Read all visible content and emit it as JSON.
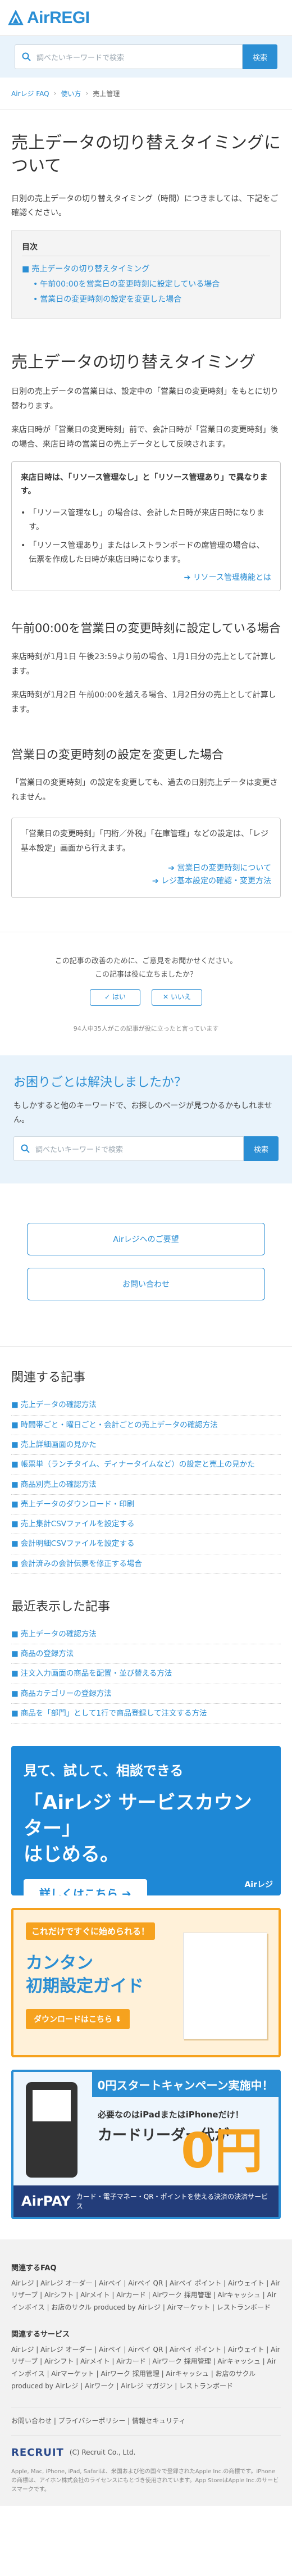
{
  "header": {
    "logo_text": "AirREGI"
  },
  "search": {
    "placeholder": "調べたいキーワードで検索",
    "button": "検索"
  },
  "breadcrumb": [
    "Airレジ FAQ",
    "使い方",
    "売上管理"
  ],
  "article": {
    "title": "売上データの切り替えタイミングについて",
    "intro": "日別の売上データの切り替えタイミング（時間）につきましては、下記をご確認ください。",
    "toc": {
      "title": "目次",
      "items": [
        {
          "label": "売上データの切り替えタイミング",
          "sub": false
        },
        {
          "label": "午前00:00を営業日の変更時刻に設定している場合",
          "sub": true
        },
        {
          "label": "営業日の変更時刻の設定を変更した場合",
          "sub": true
        }
      ]
    },
    "s1": {
      "title": "売上データの切り替えタイミング",
      "p1": "日別の売上データの営業日は、設定中の「営業日の変更時刻」をもとに切り替わります。",
      "p2": "来店日時が「営業日の変更時刻」前で、会計日時が「営業日の変更時刻」後の場合、来店日時の営業日の売上データとして反映されます。",
      "note": {
        "title": "来店日時は、「リソース管理なし」と「リソース管理あり」で異なります。",
        "items": [
          "「リソース管理なし」の場合は、会計した日時が来店日時になります。",
          "「リソース管理あり」またはレストランボードの席管理の場合は、伝票を作成した日時が来店日時になります。"
        ],
        "more": "リソース管理機能とは"
      }
    },
    "s2": {
      "title": "午前00:00を営業日の変更時刻に設定している場合",
      "p1": "来店時刻が1月1日 午後23:59より前の場合、1月1日分の売上として計算します。",
      "p2": "来店時刻が1月2日 午前00:00を越える場合、1月2日分の売上として計算します。"
    },
    "s3": {
      "title": "営業日の変更時刻の設定を変更した場合",
      "p1": "「営業日の変更時刻」の設定を変更しても、過去の日別売上データは変更されません。",
      "box_text": "「営業日の変更時刻」「円桁／外税」「在庫管理」などの設定は、「レジ基本設定」画面から行えます。",
      "links": [
        "営業日の変更時刻について",
        "レジ基本設定の確認・変更方法"
      ]
    }
  },
  "feedback": {
    "q1": "この記事の改善のために、ご意見をお聞かせください。",
    "q2": "この記事は役に立ちましたか？",
    "yes": "はい",
    "no": "いいえ",
    "note": "94人中35人がこの記事が役に立ったと言っています"
  },
  "help": {
    "title": "お困りごとは解決しましたか？",
    "text": "もしかすると他のキーワードで、お探しのページが見つかるかもしれません。"
  },
  "contact": {
    "b1": "Airレジへのご要望",
    "b2": "お問い合わせ"
  },
  "related": {
    "title": "関連する記事",
    "items": [
      "売上データの確認方法",
      "時間帯ごと・曜日ごと・会計ごとの売上データの確認方法",
      "売上詳細画面の見かた",
      "帳票単（ランチタイム、ディナータイムなど）の設定と売上の見かた",
      "商品別売上の確認方法",
      "売上データのダウンロード・印刷",
      "売上集計CSVファイルを設定する",
      "会計明細CSVファイルを設定する",
      "会計済みの会計伝票を修正する場合"
    ]
  },
  "recent": {
    "title": "最近表示した記事",
    "items": [
      "売上データの確認方法",
      "商品の登録方法",
      "注文入力画面の商品を配置・並び替える方法",
      "商品カテゴリーの登録方法",
      "商品を「部門」として1行で商品登録して注文する方法"
    ]
  },
  "banners": {
    "b1": {
      "l1": "見て、試して、相談できる",
      "l2a": "「Airレジ サービスカウンター」",
      "l2b": "はじめる。",
      "btn": "詳しくはこちら ➔",
      "tag": "Airレジ"
    },
    "b2": {
      "l1": "これだけですぐに始められる！",
      "l2a": "カンタン",
      "l2b": "初期設定ガイド",
      "btn": "ダウンロードはこちら ⬇"
    },
    "b3": {
      "top": "0円スタートキャンペーン実施中！",
      "t1": "必要なのはiPadまたはiPhoneだけ！",
      "t2": "カードリーダー代が",
      "zero": "0円",
      "ap": "AirPAY",
      "bottom": "カード・電子マネー・QR・ポイントを使える決済の決済サービス"
    }
  },
  "footer": {
    "faq_title": "関連するFAQ",
    "faq_links": "Airレジ | Airレジ オーダー | Airペイ | Airペイ QR | Airペイ ポイント | Airウェイト | Airリザーブ | Airシフト | Airメイト | Airカード | Airワーク 採用管理 | Airキャッシュ | Airインボイス | お店のサクル produced by Airレジ | Airマーケット | レストランボード",
    "svc_title": "関連するサービス",
    "svc_links": "Airレジ | Airレジ オーダー | Airペイ | Airペイ QR | Airペイ ポイント | Airウェイト | Airリザーブ | Airシフト | Airメイト | Airカード | Airワーク 採用管理 | Airキャッシュ | Airインボイス | Airマーケット | Airワーク 採用管理 | Airキャッシュ | お店のサクル produced by Airレジ | Airワーク | Airレジ マガジン | レストランボード",
    "policy": "お問い合わせ | プライバシーポリシー | 情報セキュリティ",
    "recruit": "RECRUIT",
    "copyright": "(C) Recruit Co., Ltd.",
    "legal": "Apple, Mac, iPhone, iPad, Safariは、米国および他の国々で登録されたApple Inc.の商標です。iPhoneの商標は、アイホン株式会社のライセンスにもとづき使用されています。App StoreはApple Inc.のサービスマークです。"
  }
}
